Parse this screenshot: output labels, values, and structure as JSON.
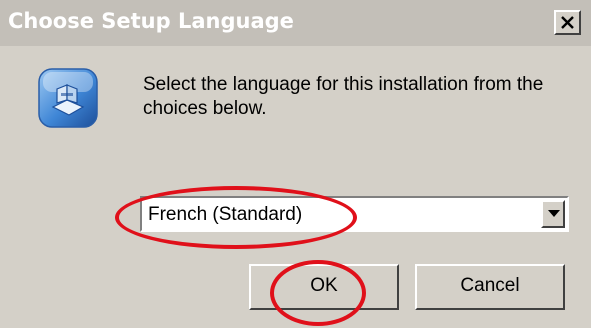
{
  "dialog": {
    "title": "Choose Setup Language",
    "close_symbol": "x",
    "icon": "installer-icon",
    "message": "Select the language for this installation from the choices below."
  },
  "language_select": {
    "selected": "French (Standard)",
    "arrow_icon": "chevron-down-icon"
  },
  "buttons": {
    "ok_label": "OK",
    "cancel_label": "Cancel"
  },
  "annotations": {
    "highlight_color": "#e0101a",
    "highlighted": [
      "language-select",
      "ok-button"
    ]
  },
  "colors": {
    "dialog_background": "#d4d0c8",
    "titlebar_background": "#c3bfb8",
    "title_text": "#ffffff"
  }
}
